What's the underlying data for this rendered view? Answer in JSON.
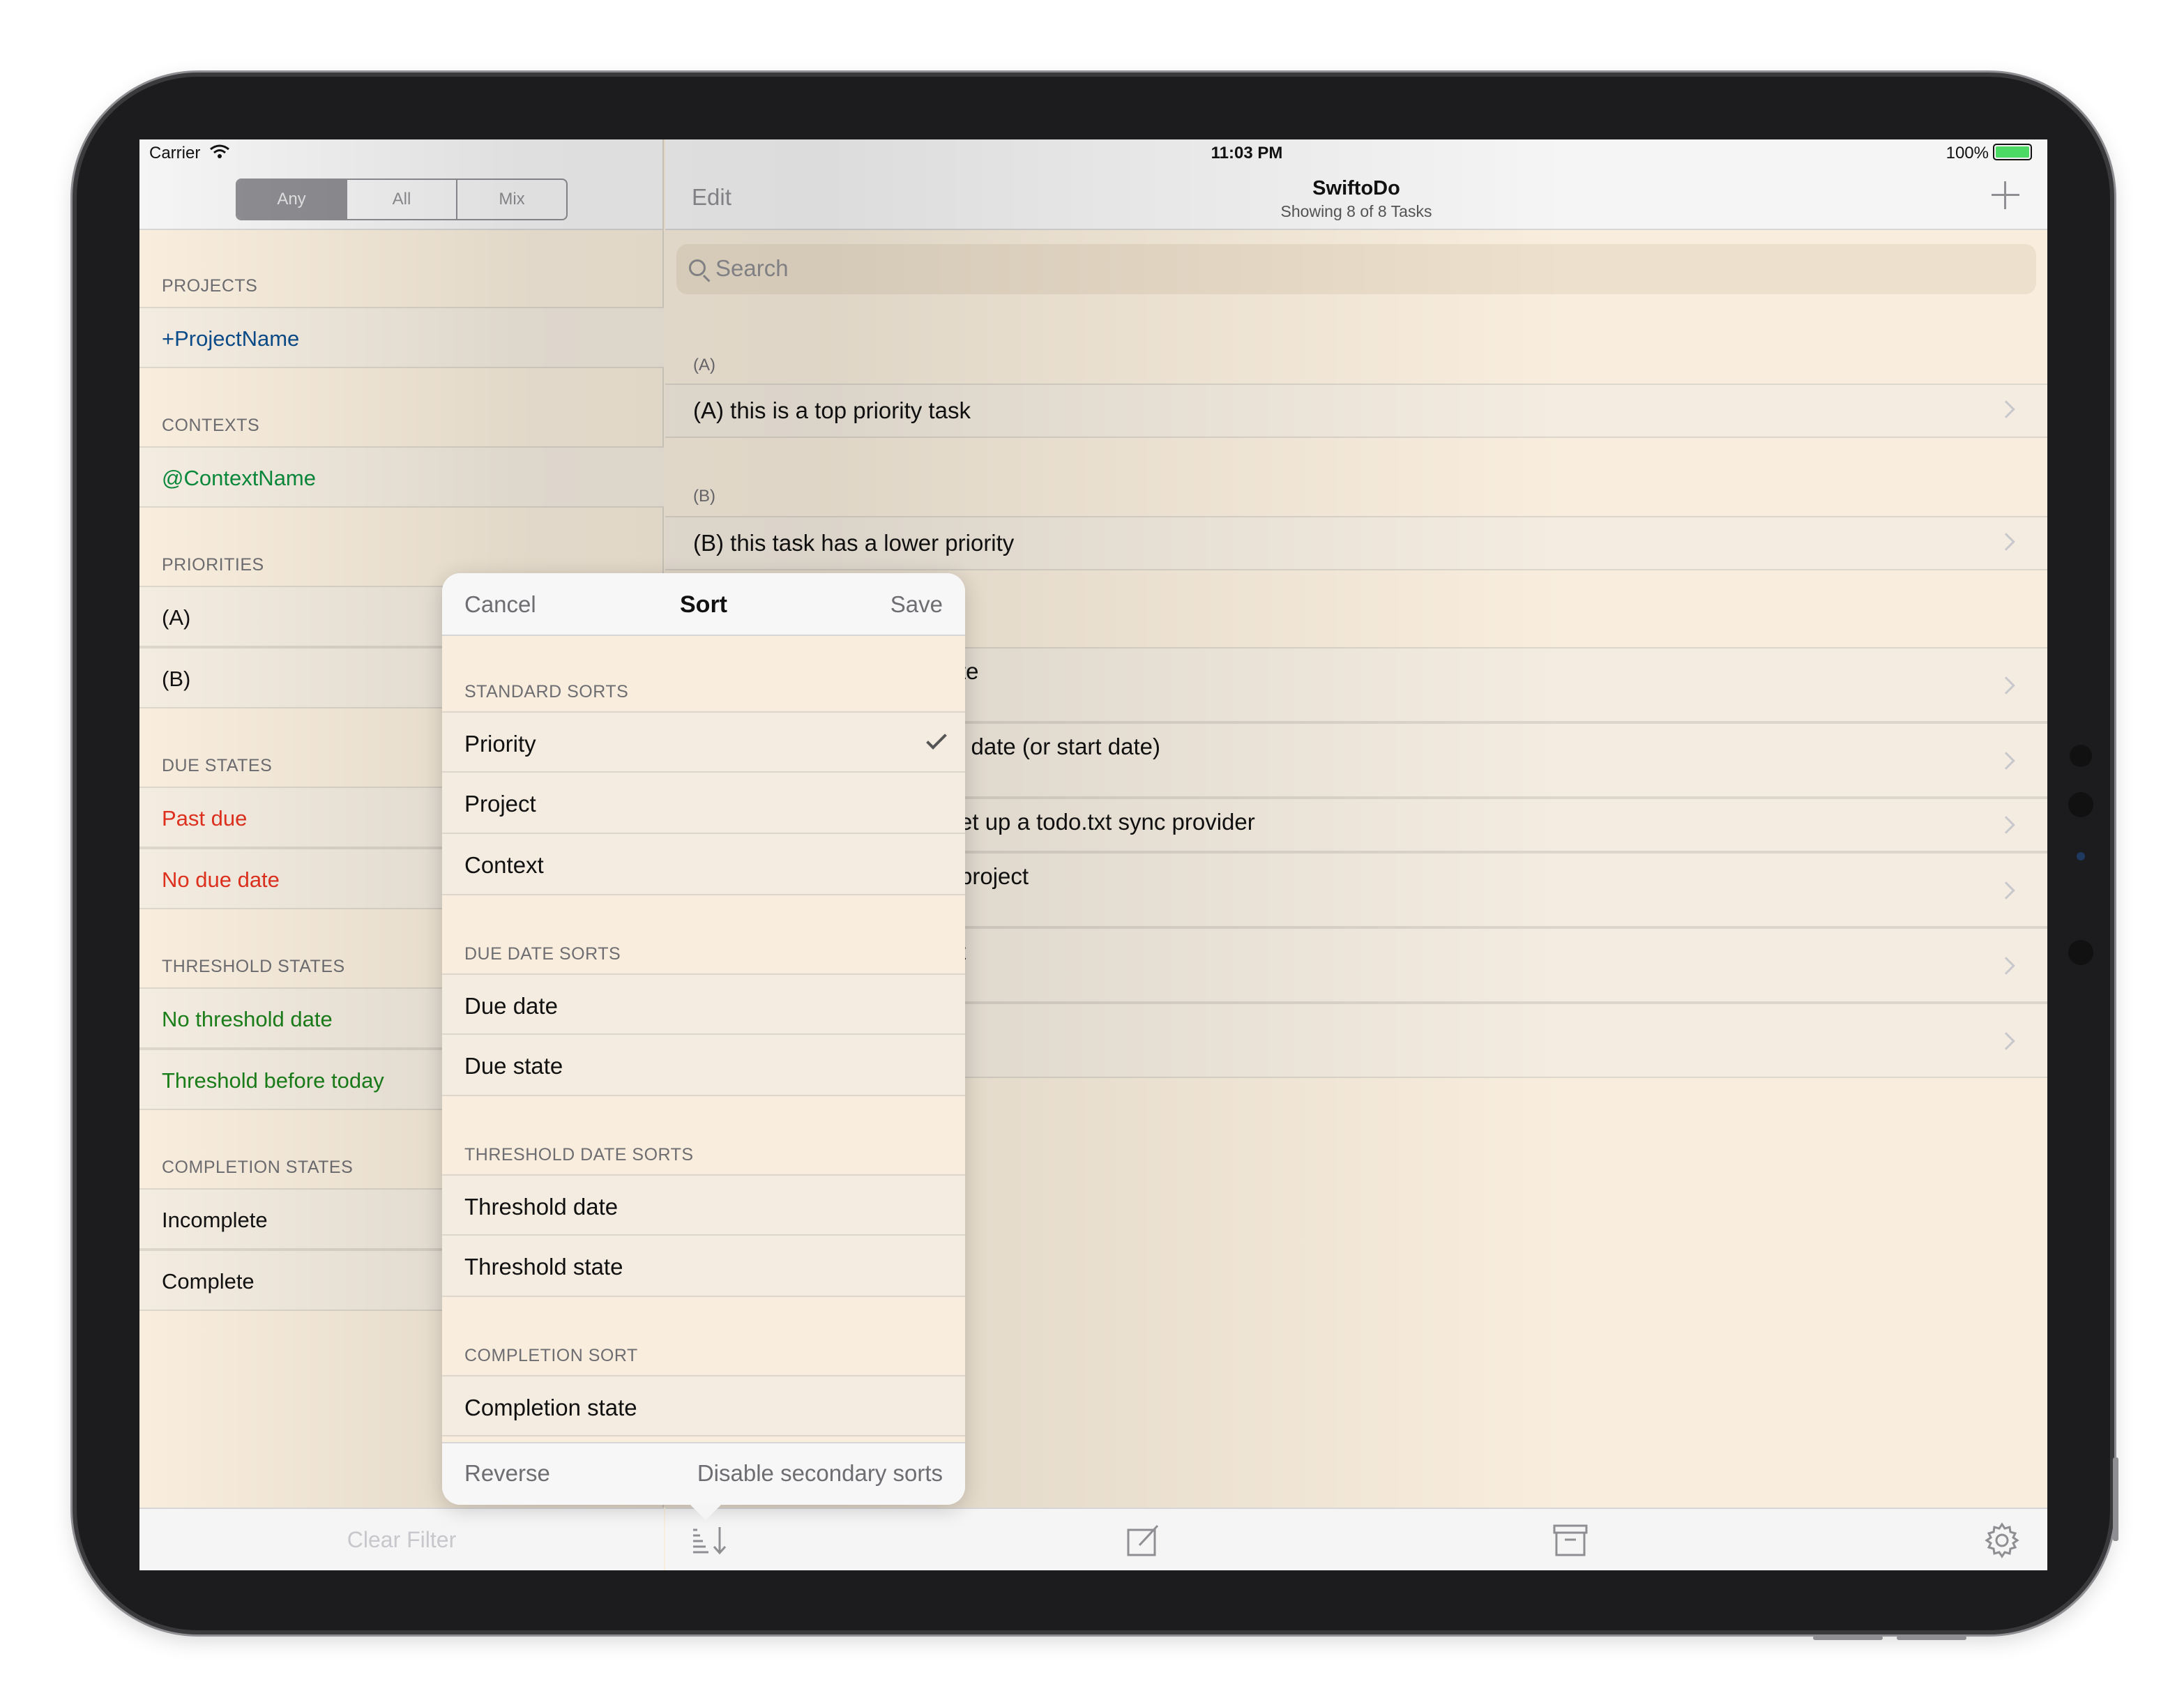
{
  "status_bar": {
    "carrier": "Carrier",
    "time": "11:03 PM",
    "battery": "100%"
  },
  "master": {
    "segments": [
      "Any",
      "All",
      "Mix"
    ],
    "active_segment": "Any",
    "sections": {
      "projects": {
        "header": "PROJECTS",
        "items": [
          "+ProjectName"
        ]
      },
      "contexts": {
        "header": "CONTEXTS",
        "items": [
          "@ContextName"
        ]
      },
      "priorities": {
        "header": "PRIORITIES",
        "items": [
          "(A)",
          "(B)"
        ]
      },
      "due_states": {
        "header": "DUE STATES",
        "items": [
          "Past due",
          "No due date"
        ]
      },
      "threshold_states": {
        "header": "THRESHOLD STATES",
        "items": [
          "No threshold date",
          "Threshold before today"
        ]
      },
      "completion_states": {
        "header": "COMPLETION STATES",
        "items": [
          "Incomplete",
          "Complete"
        ]
      }
    },
    "clear_filter": "Clear Filter"
  },
  "detail": {
    "edit": "Edit",
    "title": "SwiftoDo",
    "subtitle": "Showing 8 of 8 Tasks",
    "search_placeholder": "Search",
    "groups": [
      {
        "header": "(A)",
        "task": "(A)  this is a top priority task"
      },
      {
        "header": "(B)",
        "task": "(B)  this task has a lower priority"
      }
    ],
    "partial_tasks": [
      "te",
      "l date (or start date)",
      "et up a todo.txt sync provider",
      "project",
      "t",
      "l"
    ]
  },
  "sort_popover": {
    "cancel": "Cancel",
    "title": "Sort",
    "save": "Save",
    "sections": [
      {
        "header": "STANDARD SORTS",
        "items": [
          "Priority",
          "Project",
          "Context"
        ]
      },
      {
        "header": "DUE DATE SORTS",
        "items": [
          "Due date",
          "Due state"
        ]
      },
      {
        "header": "THRESHOLD DATE SORTS",
        "items": [
          "Threshold date",
          "Threshold state"
        ]
      },
      {
        "header": "COMPLETION SORT",
        "items": [
          "Completion state"
        ]
      }
    ],
    "selected": "Priority",
    "reverse": "Reverse",
    "disable_secondary": "Disable secondary sorts"
  },
  "colors": {
    "project": "#0a4c8a",
    "context": "#0a8a3c",
    "due": "#e0301e",
    "threshold": "#1a7f1a",
    "background": "#f9eedd"
  },
  "icons": [
    "wifi-icon",
    "battery-icon",
    "plus-icon",
    "search-icon",
    "chevron-right-icon",
    "sort-icon",
    "compose-icon",
    "archive-icon",
    "gear-icon",
    "checkmark-icon"
  ]
}
